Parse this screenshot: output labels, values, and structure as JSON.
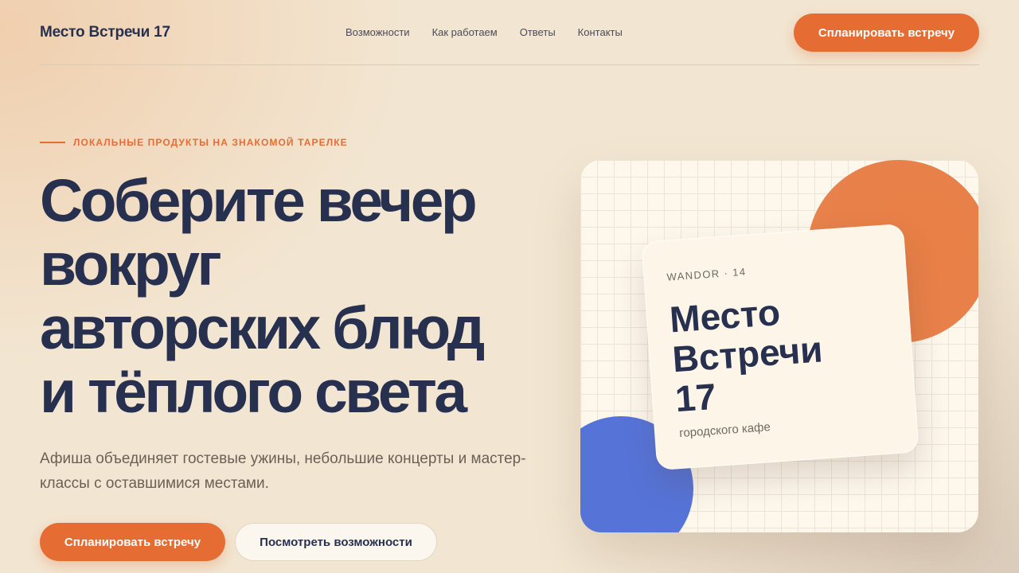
{
  "header": {
    "logo": "Место Встречи 17",
    "nav": [
      "Возможности",
      "Как работаем",
      "Ответы",
      "Контакты"
    ],
    "cta": "Спланировать встречу"
  },
  "hero": {
    "eyebrow": "ЛОКАЛЬНЫЕ ПРОДУКТЫ НА ЗНАКОМОЙ ТАРЕЛКЕ",
    "headline_lines": [
      "Соберите вечер",
      "вокруг",
      "авторских блюд",
      "и тёплого света"
    ],
    "subtitle": "Афиша объединяет гостевые ужины, небольшие концерты и мастер-классы с оставшимися местами.",
    "primary_cta": "Спланировать встречу",
    "secondary_cta": "Посмотреть возможности"
  },
  "card": {
    "tag": "WANDOR · 14",
    "title_lines": [
      "Место",
      "Встречи",
      "17"
    ],
    "subtitle": "городского кафе"
  },
  "colors": {
    "accent": "#e56d34",
    "navy": "#27304f",
    "blue": "#5674d8",
    "background": "#f2e6d2"
  }
}
